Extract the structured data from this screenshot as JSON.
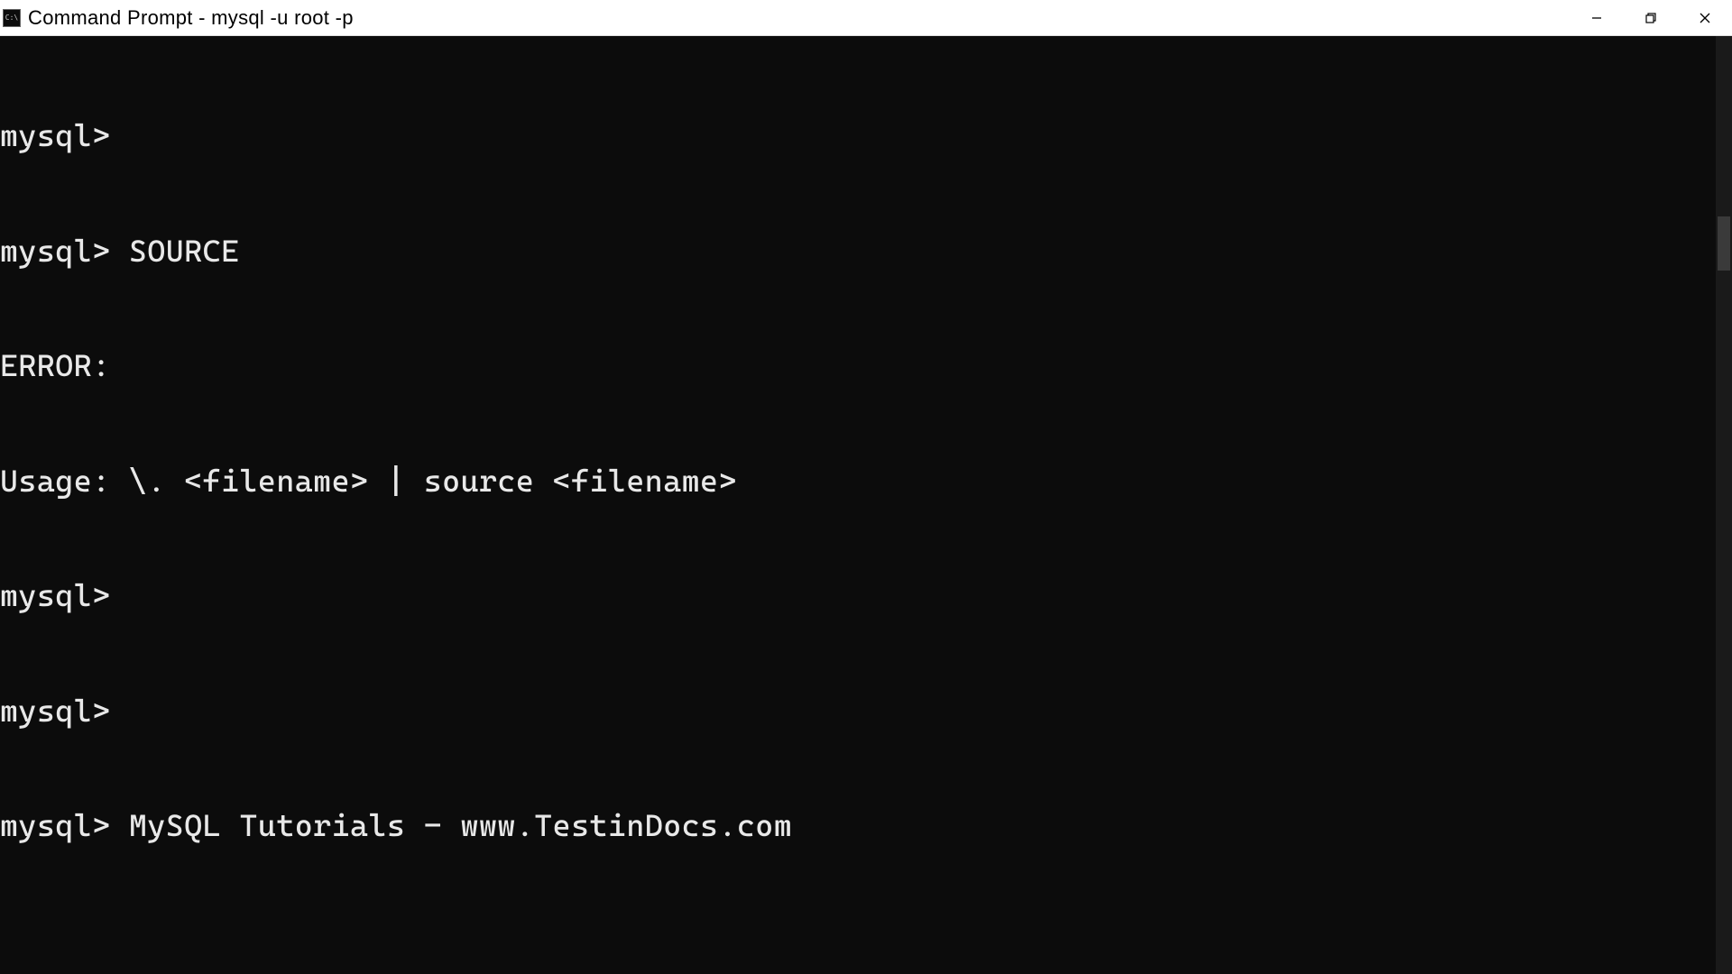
{
  "window": {
    "title": "Command Prompt - mysql  -u root -p"
  },
  "terminal": {
    "lines": [
      "mysql>",
      "mysql> SOURCE",
      "ERROR:",
      "Usage: \\. <filename> | source <filename>",
      "mysql>",
      "mysql>",
      "mysql> MySQL Tutorials - www.TestinDocs.com"
    ]
  }
}
